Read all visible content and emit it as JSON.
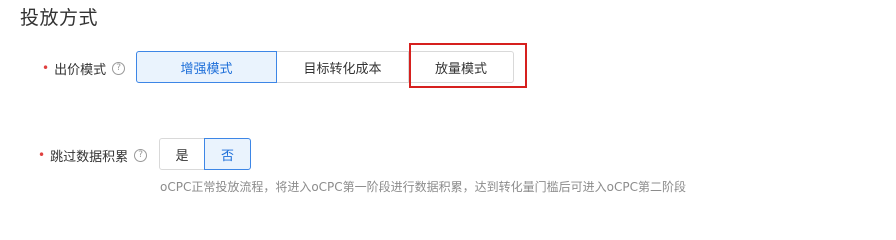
{
  "section": {
    "title": "投放方式"
  },
  "bid_mode": {
    "label": "出价模式",
    "required_mark": "•",
    "help_icon": "question-circle-icon",
    "help_glyph": "?",
    "options": [
      "增强模式",
      "目标转化成本",
      "放量模式"
    ],
    "selected": "增强模式"
  },
  "skip_data": {
    "label": "跳过数据积累",
    "required_mark": "•",
    "help_icon": "question-circle-icon",
    "help_glyph": "?",
    "options": [
      "是",
      "否"
    ],
    "selected": "否",
    "hint": "oCPC正常投放流程，将进入oCPC第一阶段进行数据积累，达到转化量门槛后可进入oCPC第二阶段"
  },
  "colors": {
    "accent": "#1e6fd9",
    "active_bg": "#eaf3fd",
    "required": "#e0403f",
    "annotation_box": "#d6201e"
  }
}
